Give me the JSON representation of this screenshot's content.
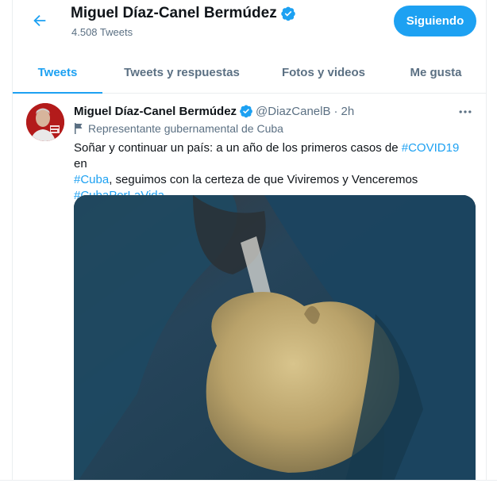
{
  "header": {
    "name": "Miguel Díaz-Canel Bermúdez",
    "tweet_count": "4.508 Tweets",
    "follow_label": "Siguiendo"
  },
  "tabs": [
    {
      "label": "Tweets",
      "active": true
    },
    {
      "label": "Tweets y respuestas",
      "active": false
    },
    {
      "label": "Fotos y videos",
      "active": false
    },
    {
      "label": "Me gusta",
      "active": false
    }
  ],
  "tweet": {
    "name": "Miguel Díaz-Canel Bermúdez",
    "handle": "@DiazCanelB",
    "dot": "·",
    "time": "2h",
    "account_label": "Representante gubernamental de Cuba",
    "text_part1": "Soñar y continuar un país: a un año de los primeros casos de ",
    "hashtag1": "#COVID19",
    "text_part2": " en",
    "hashtag2": "#Cuba",
    "text_part3": ", seguimos con la certeza de que Viviremos y Venceremos",
    "hashtag3": "#CubaPorLaVida"
  },
  "colors": {
    "accent": "#1da1f2",
    "muted": "#5b7083",
    "text": "#0f1419"
  },
  "icons": {
    "back": "arrow-left-icon",
    "verified": "verified-badge-icon",
    "more": "more-horizontal-icon",
    "label": "flag-icon"
  }
}
